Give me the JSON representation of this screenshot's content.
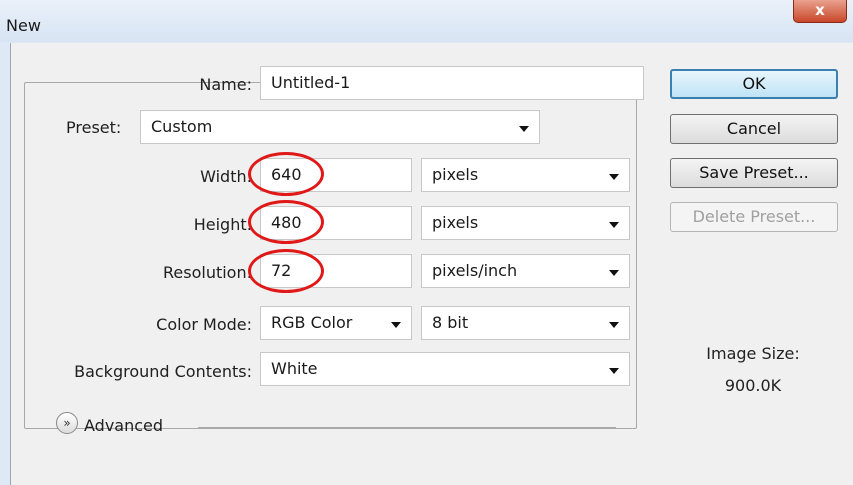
{
  "window": {
    "title": "New",
    "close_symbol": "x"
  },
  "form": {
    "name": {
      "label": "Name:",
      "value": "Untitled-1"
    },
    "preset": {
      "label": "Preset:",
      "value": "Custom"
    },
    "width": {
      "label": "Width:",
      "value": "640",
      "unit": "pixels"
    },
    "height": {
      "label": "Height:",
      "value": "480",
      "unit": "pixels"
    },
    "resolution": {
      "label": "Resolution:",
      "value": "72",
      "unit": "pixels/inch"
    },
    "color_mode": {
      "label": "Color Mode:",
      "value": "RGB Color",
      "depth": "8 bit"
    },
    "background": {
      "label": "Background Contents:",
      "value": "White"
    },
    "advanced": {
      "label": "Advanced",
      "icon": "double-chevron-down-icon"
    }
  },
  "buttons": {
    "ok": "OK",
    "cancel": "Cancel",
    "save_preset": "Save Preset...",
    "delete_preset": "Delete Preset..."
  },
  "image_size": {
    "label": "Image Size:",
    "value": "900.0K"
  },
  "annotation": {
    "color": "#e01818"
  },
  "colors": {
    "ok_border": "#3c7fb1",
    "close_button": "#c9472a"
  }
}
